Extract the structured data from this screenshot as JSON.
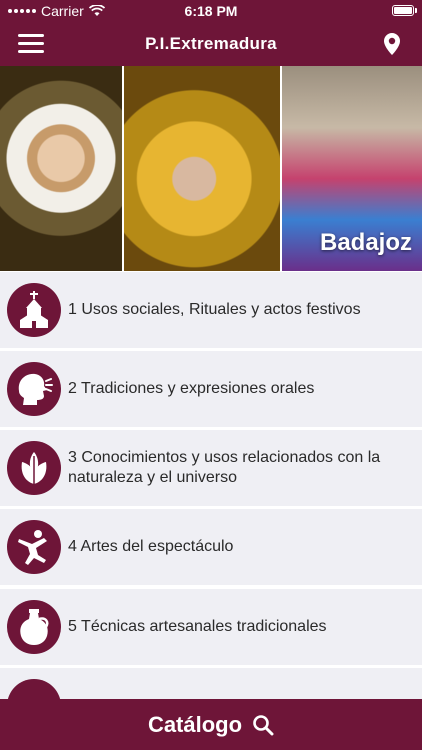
{
  "status_bar": {
    "carrier": "Carrier",
    "time": "6:18 PM"
  },
  "navbar": {
    "title": "P.I.Extremadura",
    "menu_icon": "hamburger-menu-icon",
    "location_icon": "location-pin-icon"
  },
  "banner": {
    "label": "Badajoz"
  },
  "categories": [
    {
      "label": "1 Usos sociales, Rituales y actos festivos",
      "icon": "church-icon"
    },
    {
      "label": "2 Tradiciones y expresiones orales",
      "icon": "speaking-head-icon"
    },
    {
      "label": "3 Conocimientos y usos relacionados con la naturaleza y el universo",
      "icon": "leaves-icon"
    },
    {
      "label": "4 Artes del espectáculo",
      "icon": "dancer-icon"
    },
    {
      "label": "5 Técnicas artesanales tradicionales",
      "icon": "pottery-jug-icon"
    },
    {
      "label": "",
      "icon": "partial-item-icon"
    }
  ],
  "footer": {
    "label": "Catálogo",
    "icon": "search-icon"
  },
  "colors": {
    "brand": "#6e1538",
    "list_background": "#efeff4"
  }
}
